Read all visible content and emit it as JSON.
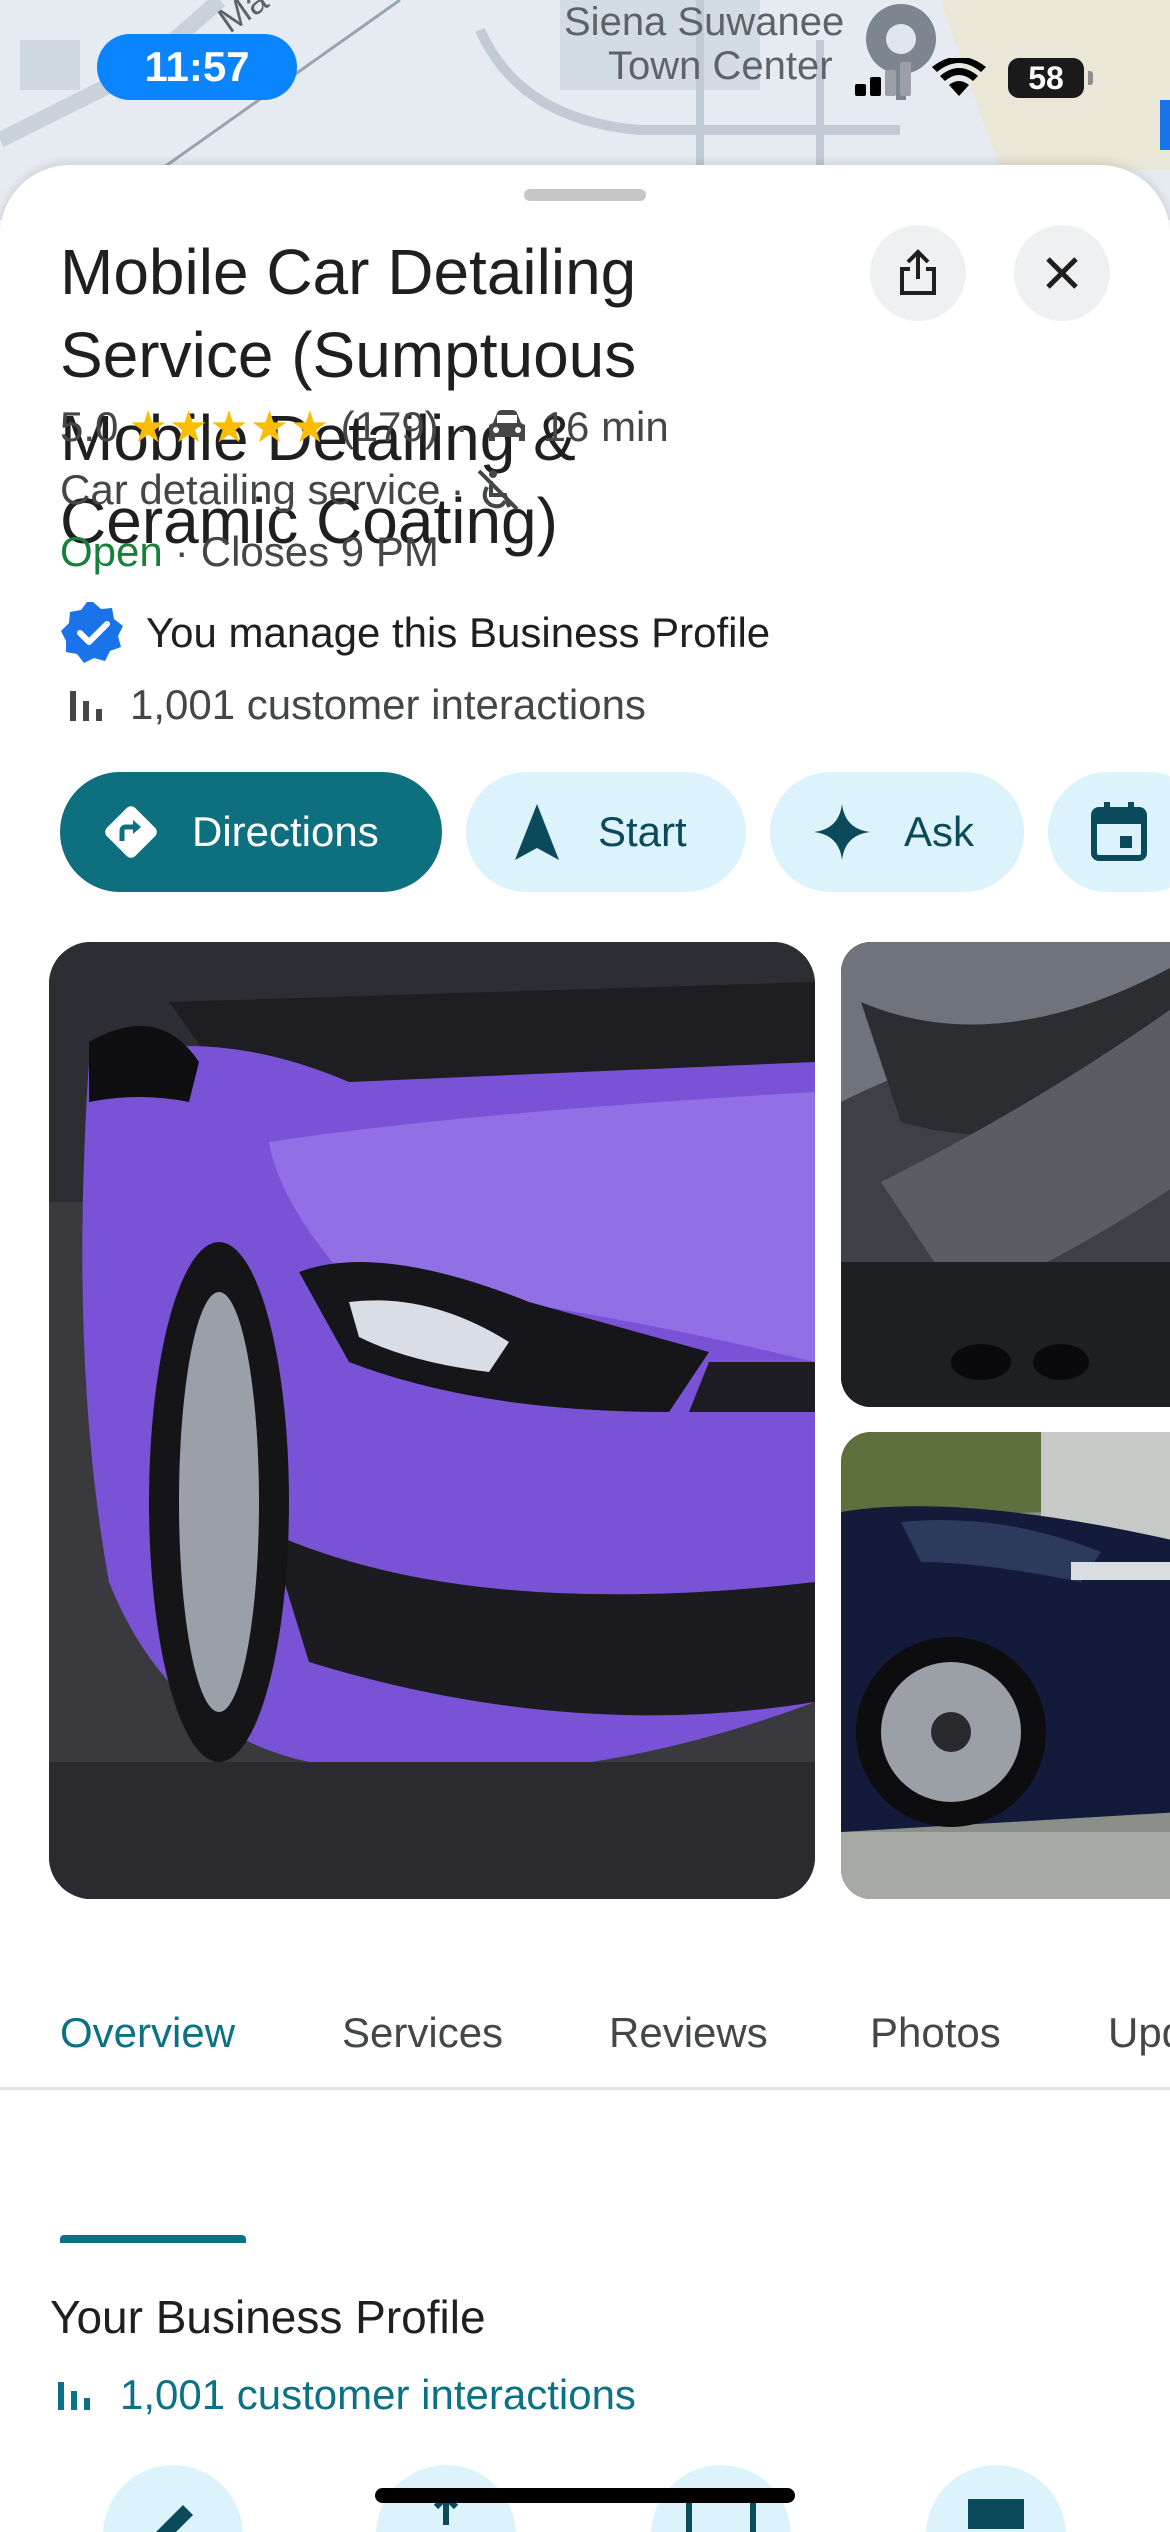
{
  "status_bar": {
    "time": "11:57",
    "battery": "58"
  },
  "map": {
    "label_line1": "Siena Suwanee",
    "label_line2": "Town Center",
    "road_fragment": "Ma"
  },
  "place": {
    "title": "Mobile Car Detailing Service (Sumptuous Mobile Detailing & Ceramic Coating)",
    "rating": "5.0",
    "stars": "★★★★★",
    "review_count": "(179)",
    "drive_time": "16 min",
    "category": "Car detailing service",
    "open_status": "Open",
    "closes": "Closes 9 PM",
    "manage_text": "You manage this Business Profile",
    "interactions": "1,001 customer interactions"
  },
  "actions": [
    {
      "label": "Directions",
      "icon": "directions-icon"
    },
    {
      "label": "Start",
      "icon": "navigation-arrow-icon"
    },
    {
      "label": "Ask",
      "icon": "sparkle-icon"
    },
    {
      "label": "",
      "icon": "calendar-icon"
    }
  ],
  "tabs": [
    "Overview",
    "Services",
    "Reviews",
    "Photos",
    "Upd"
  ],
  "active_tab": "Overview",
  "profile_section": {
    "title": "Your Business Profile",
    "link": "1,001 customer interactions"
  },
  "colors": {
    "accent": "#0b7285",
    "open_green": "#188038",
    "star": "#fbbc04",
    "chip_light": "#dcf3fb",
    "verified_blue": "#1a73e8"
  }
}
